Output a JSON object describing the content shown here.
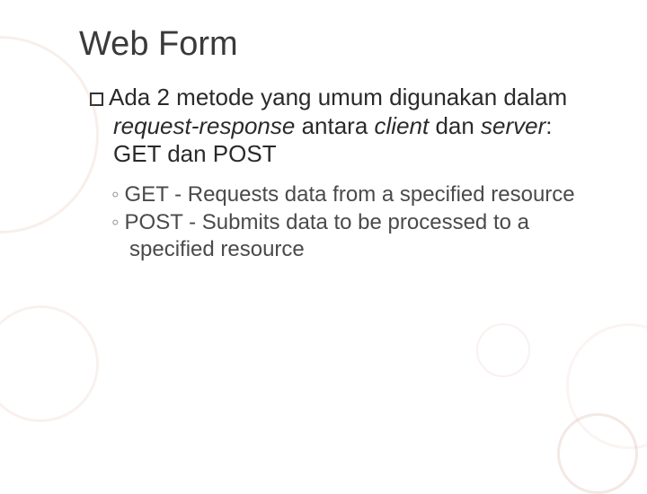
{
  "title": "Web Form",
  "main": {
    "pre": "Ada 2 metode yang umum digunakan dalam ",
    "it1": "request-response",
    "mid1": " antara ",
    "it2": "client",
    "mid2": " dan ",
    "it3": "server",
    "post": ": GET dan POST"
  },
  "subs": [
    "GET - Requests data from a specified resource",
    "POST - Submits data to be processed to a specified resource"
  ]
}
